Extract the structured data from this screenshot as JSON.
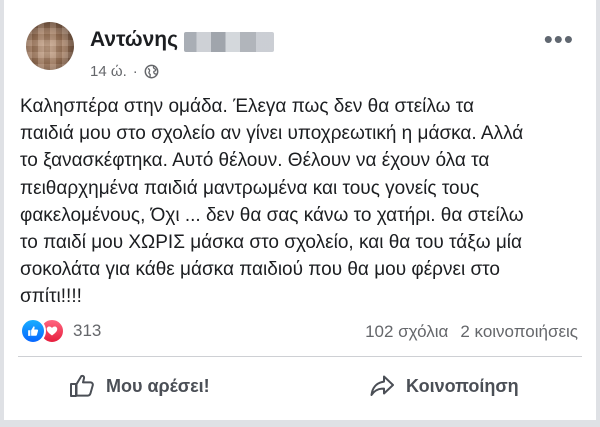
{
  "post": {
    "author_name": "Αντώνης",
    "time": "14 ώ.",
    "separator": "·",
    "text": "Καλησπέρα στην ομάδα. Έλεγα πως δεν θα στείλω τα\nπαιδιά μου στο σχολείο αν γίνει υποχρεωτική η μάσκα. Αλλά\nτο ξανασκέφτηκα. Αυτό θέλουν. Θέλουν να έχουν όλα τα\nπειθαρχημένα παιδιά μαντρωμένα και τους γονείς τους\nφακελομένους, Όχι ... δεν θα σας κάνω το χατήρι. θα στείλω\nτο παιδί μου ΧΩΡΙΣ μάσκα στο σχολείο, και θα του τάξω μία\nσοκολάτα για κάθε μάσκα παιδιού που θα μου φέρνει στο\nσπίτι!!!!"
  },
  "engagement": {
    "reaction_count": "313",
    "comments": "102 σχόλια",
    "shares": "2 κοινοποιήσεις"
  },
  "actions": {
    "like_label": "Μου αρέσει!",
    "share_label": "Κοινοποίηση"
  },
  "icons": {
    "privacy": "globe-icon",
    "more": "more-options-icon",
    "like": "thumbs-up-icon",
    "share": "share-arrow-icon"
  },
  "colors": {
    "like_reaction": "#0866ff",
    "love_reaction": "#e61e3d",
    "text": "#1c1e21",
    "secondary_text": "#65676b"
  }
}
